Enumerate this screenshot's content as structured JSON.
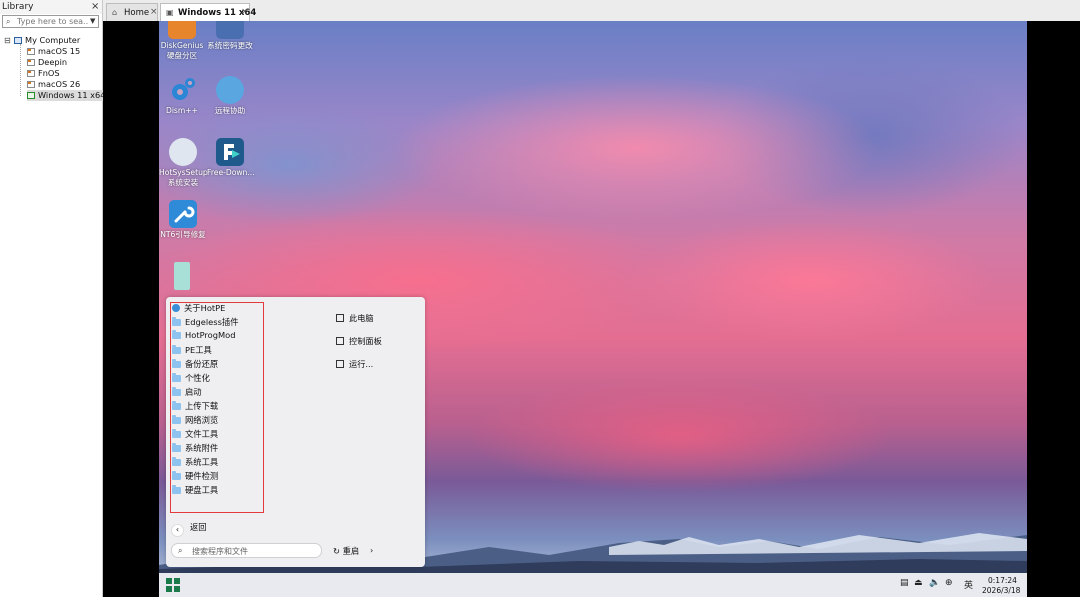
{
  "library": {
    "title": "Library",
    "close": "×",
    "search_placeholder": "Type here to sea...",
    "tree": {
      "root": "My Computer",
      "items": [
        "macOS 15",
        "Deepin",
        "FnOS",
        "macOS 26",
        "Windows 11 x64"
      ],
      "selected": "Windows 11 x64"
    }
  },
  "tabs": [
    {
      "label": "Home",
      "close": "×"
    },
    {
      "label": "Windows 11 x64",
      "close": "×",
      "active": true
    }
  ],
  "desktop_icons": [
    {
      "label": "DiskGenius\n硬盘分区",
      "l1": "DiskGenius",
      "l2": "硬盘分区"
    },
    {
      "l1": "系统密码更改",
      "l2": ""
    },
    {
      "l1": "Dism++",
      "l2": ""
    },
    {
      "l1": "远程协助",
      "l2": ""
    },
    {
      "l1": "HotSysSetup",
      "l2": "系统安装"
    },
    {
      "l1": "Free-Down...",
      "l2": ""
    },
    {
      "l1": "NT6引导修复",
      "l2": ""
    }
  ],
  "start_menu": {
    "left_items": [
      "关于HotPE",
      "Edgeless插件",
      "HotProgMod",
      "PE工具",
      "备份还原",
      "个性化",
      "启动",
      "上传下载",
      "网络浏览",
      "文件工具",
      "系统附件",
      "系统工具",
      "硬件检测",
      "硬盘工具"
    ],
    "right_items": [
      "此电脑",
      "控制面板",
      "运行..."
    ],
    "back_label": "返回",
    "search_placeholder": "搜索程序和文件",
    "restart_label": "重启",
    "restart_chevron": "›"
  },
  "taskbar": {
    "time": "0:17:24",
    "date": "2026/3/18",
    "lang": "英"
  },
  "colors": {
    "selection_box": "#e23b3b",
    "folder": "#8ec3ef",
    "taskbar": "#e9eaef"
  }
}
